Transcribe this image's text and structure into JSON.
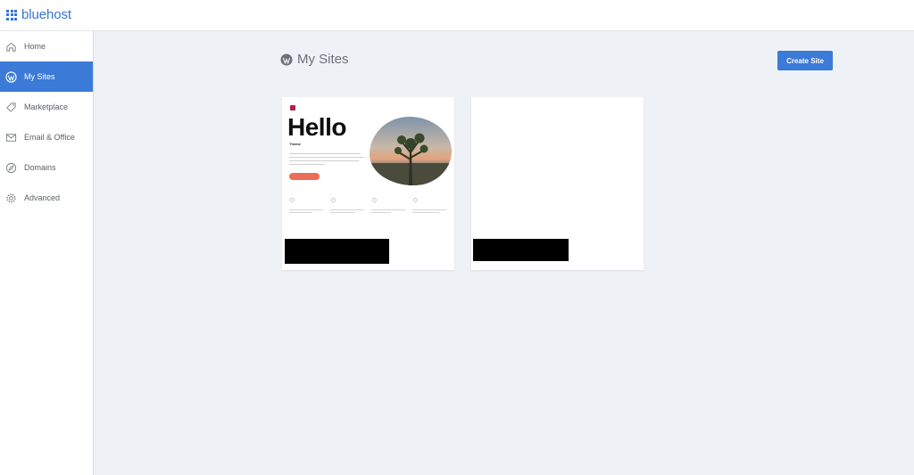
{
  "brand": {
    "name": "bluehost",
    "color": "#3575d3"
  },
  "sidebar": {
    "items": [
      {
        "label": "Home",
        "icon": "home-icon",
        "active": false
      },
      {
        "label": "My Sites",
        "icon": "wordpress-icon",
        "active": true
      },
      {
        "label": "Marketplace",
        "icon": "tag-icon",
        "active": false
      },
      {
        "label": "Email & Office",
        "icon": "envelope-icon",
        "active": false
      },
      {
        "label": "Domains",
        "icon": "compass-icon",
        "active": false
      },
      {
        "label": "Advanced",
        "icon": "gear-icon",
        "active": false
      }
    ]
  },
  "main": {
    "title": "My Sites",
    "title_icon": "wordpress-icon",
    "create_button": "Create Site"
  },
  "sites": [
    {
      "preview": {
        "heading": "Hello",
        "subheading": "Theme"
      },
      "name_redacted": true
    },
    {
      "preview": null,
      "name_redacted": true
    }
  ],
  "annotation": {
    "type": "red-arrow",
    "points_to": "My Sites",
    "color": "#e3141b"
  },
  "colors": {
    "accent": "#3b7ad6",
    "background": "#eef1f6"
  }
}
